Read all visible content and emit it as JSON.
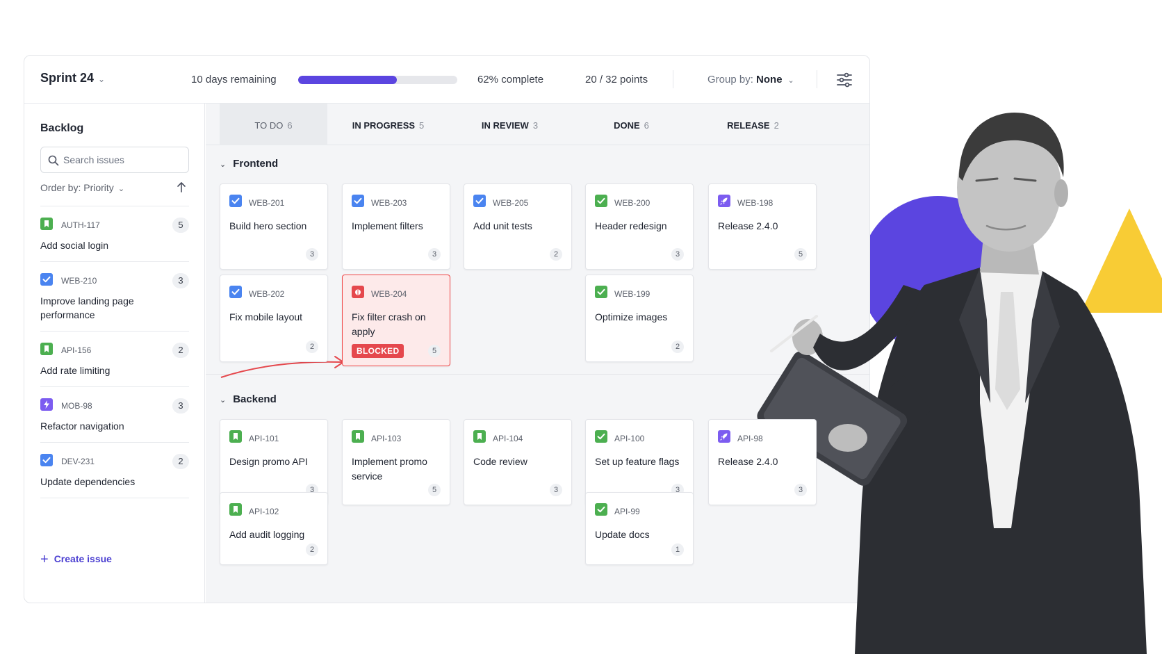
{
  "sprint": {
    "title": "Sprint 24",
    "days_remaining": "10 days remaining",
    "progress_fraction": 0.62,
    "percent_label": "62% complete",
    "points_label": "20 / 32 points",
    "group_by_label": "Group by:",
    "group_by_value": "None"
  },
  "colors": {
    "accent": "#5b45e0",
    "blocked": "#e5484d",
    "story": "#4caf50",
    "task": "#4a84f0",
    "bug": "#e5484d",
    "release": "#7c5cf0"
  },
  "backlog": {
    "title": "Backlog",
    "search_placeholder": "Search issues",
    "order_by": "Order by: Priority",
    "items": [
      {
        "key": "AUTH-117",
        "title": "Add social login",
        "points": "5",
        "icon": "story-icon"
      },
      {
        "key": "WEB-210",
        "title": "Improve landing page performance",
        "points": "3",
        "icon": "task-icon"
      },
      {
        "key": "API-156",
        "title": "Add rate limiting",
        "points": "2",
        "icon": "story-icon"
      },
      {
        "key": "MOB-98",
        "title": "Refactor navigation",
        "points": "3",
        "icon": "epic-icon"
      },
      {
        "key": "DEV-231",
        "title": "Update dependencies",
        "points": "2",
        "icon": "task-icon"
      }
    ],
    "create_label": "Create issue"
  },
  "columns": [
    {
      "label": "TO DO",
      "count": "6"
    },
    {
      "label": "IN PROGRESS",
      "count": "5"
    },
    {
      "label": "IN REVIEW",
      "count": "3"
    },
    {
      "label": "DONE",
      "count": "6"
    },
    {
      "label": "RELEASE",
      "count": "2"
    }
  ],
  "groups": [
    {
      "name": "Frontend",
      "cards": [
        {
          "col": 0,
          "row": 0,
          "key": "WEB-201",
          "title": "Build hero section",
          "points": "3",
          "icon": "task-icon"
        },
        {
          "col": 0,
          "row": 1,
          "key": "WEB-202",
          "title": "Fix mobile layout",
          "points": "2",
          "icon": "task-icon"
        },
        {
          "col": 1,
          "row": 0,
          "key": "WEB-203",
          "title": "Implement filters",
          "points": "3",
          "icon": "task-icon"
        },
        {
          "col": 1,
          "row": 1,
          "key": "WEB-204",
          "title": "Fix filter crash on apply",
          "points": "5",
          "icon": "bug-icon",
          "tag": "BLOCKED"
        },
        {
          "col": 2,
          "row": 0,
          "key": "WEB-205",
          "title": "Add unit tests",
          "points": "2",
          "icon": "task-icon"
        },
        {
          "col": 3,
          "row": 0,
          "key": "WEB-200",
          "title": "Header redesign",
          "points": "3",
          "icon": "done-icon"
        },
        {
          "col": 3,
          "row": 1,
          "key": "WEB-199",
          "title": "Optimize images",
          "points": "2",
          "icon": "done-icon"
        },
        {
          "col": 4,
          "row": 0,
          "key": "WEB-198",
          "title": "Release 2.4.0",
          "points": "5",
          "icon": "rocket-icon"
        }
      ]
    },
    {
      "name": "Backend",
      "cards": [
        {
          "col": 0,
          "row": 0,
          "key": "API-101",
          "title": "Design promo API",
          "points": "3",
          "icon": "story-icon"
        },
        {
          "col": 0,
          "row": 1,
          "key": "API-102",
          "title": "Add audit logging",
          "points": "2",
          "icon": "story-icon"
        },
        {
          "col": 1,
          "row": 0,
          "key": "API-103",
          "title": "Implement promo service",
          "points": "5",
          "icon": "story-icon"
        },
        {
          "col": 2,
          "row": 0,
          "key": "API-104",
          "title": "Code review",
          "points": "3",
          "icon": "story-icon"
        },
        {
          "col": 3,
          "row": 0,
          "key": "API-100",
          "title": "Set up feature flags",
          "points": "3",
          "icon": "done-icon"
        },
        {
          "col": 3,
          "row": 1,
          "key": "API-99",
          "title": "Update docs",
          "points": "1",
          "icon": "done-icon"
        },
        {
          "col": 4,
          "row": 0,
          "key": "API-98",
          "title": "Release 2.4.0",
          "points": "3",
          "icon": "rocket-icon"
        }
      ]
    }
  ]
}
